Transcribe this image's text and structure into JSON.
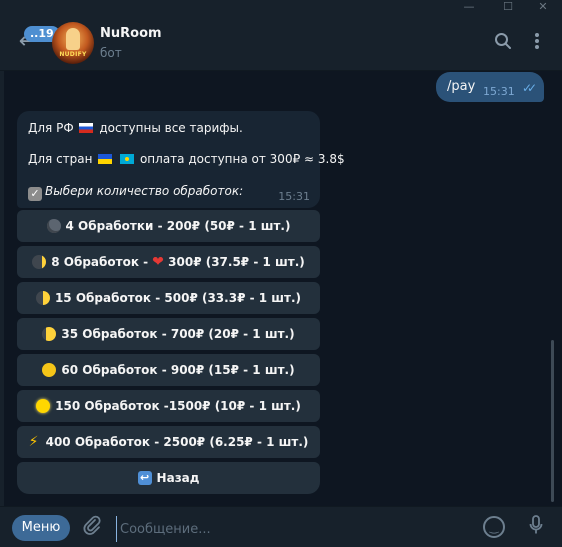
{
  "window": {
    "minimize_glyph": "—",
    "maximize_glyph": "☐",
    "close_glyph": "✕"
  },
  "header": {
    "unread_count": "..19",
    "chat_title": "NuRoom",
    "chat_subtitle": "бот",
    "avatar_text": "NUDIFY",
    "icons": [
      "back-arrow-icon",
      "search-icon",
      "more-vertical-icon"
    ]
  },
  "messages": {
    "outgoing": {
      "text": "/pay",
      "time": "15:31",
      "status": "read"
    },
    "incoming": {
      "line1_before": "Для РФ",
      "line1_after": "доступны все тарифы.",
      "line2_before": "Для стран",
      "line2_after": "оплата доступна от 300₽ ≈ 3.8$",
      "line3": "Выбери количество обработок:",
      "time": "15:31"
    }
  },
  "keyboard": {
    "buttons": [
      {
        "label": "4 Обработки - 200₽ (50₽ - 1 шт.)",
        "emoji": "new-moon"
      },
      {
        "label_before": "8 Обработок - ",
        "label_after": "300₽ (37.5₽ - 1 шт.)",
        "emoji": "waxing-crescent-moon",
        "emoji2": "heart-on-fire"
      },
      {
        "label": "15 Обработок - 500₽ (33.3₽ - 1 шт.)",
        "emoji": "first-quarter-moon"
      },
      {
        "label": "35 Обработок - 700₽ (20₽ - 1 шт.)",
        "emoji": "waxing-gibbous-moon"
      },
      {
        "label": "60 Обработок - 900₽ (15₽ - 1 шт.)",
        "emoji": "full-moon"
      },
      {
        "label": "150 Обработок -1500₽ (10₽ - 1 шт.)",
        "emoji": "full-moon-bright"
      },
      {
        "label": "400 Обработок - 2500₽ (6.25₽ - 1 шт.)",
        "emoji": "high-voltage"
      },
      {
        "label": "Назад",
        "emoji": "back-arrow"
      }
    ]
  },
  "composer": {
    "menu_label": "Меню",
    "placeholder": "Сообщение..."
  },
  "colors": {
    "background": "#0e1621",
    "panel": "#17212b",
    "outgoing_bubble": "#2b5278",
    "incoming_bubble": "#182533",
    "keyboard_button": "#23303c",
    "accent": "#4e8fd1"
  }
}
